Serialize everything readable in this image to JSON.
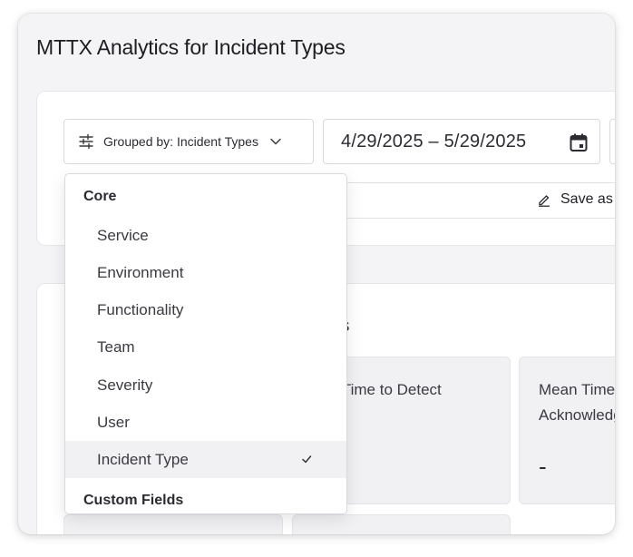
{
  "page": {
    "title": "MTTX Analytics for Incident Types"
  },
  "filters": {
    "group_by_label": "Grouped by: Incident Types",
    "date_range": "4/29/2025 – 5/29/2025",
    "save_label": "Save as"
  },
  "metrics": {
    "section_title": "nts",
    "detect_label": "n Time to Detect",
    "ack_label": "Mean Time to Acknowledge",
    "ack_value": "-"
  },
  "dropdown": {
    "core_header": "Core",
    "items": [
      {
        "label": "Service"
      },
      {
        "label": "Environment"
      },
      {
        "label": "Functionality"
      },
      {
        "label": "Team"
      },
      {
        "label": "Severity"
      },
      {
        "label": "User"
      },
      {
        "label": "Incident Type",
        "selected": true
      }
    ],
    "custom_header": "Custom Fields"
  },
  "icons": {
    "group_by": "sliders-icon",
    "dropdown": "chevron-down-icon",
    "date": "calendar-icon",
    "save": "pencil-icon",
    "selected": "check-icon"
  },
  "colors": {
    "selected_row": "#f1f1f4",
    "card_bg": "#ffffff",
    "page_bg": "#f4f4f6"
  }
}
